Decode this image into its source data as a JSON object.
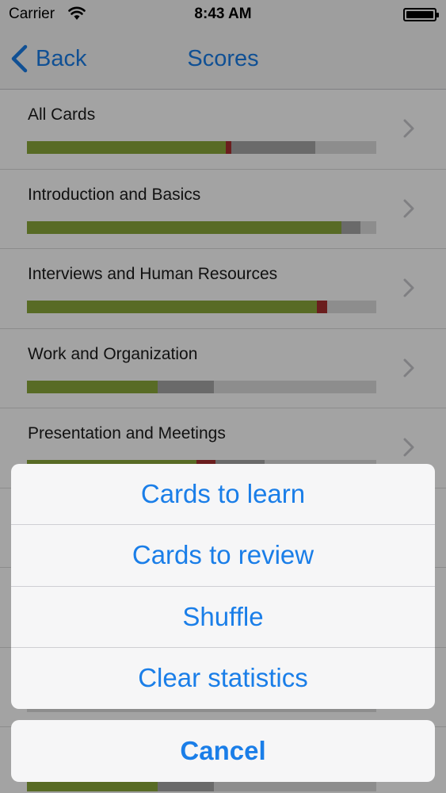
{
  "status_bar": {
    "carrier": "Carrier",
    "time": "8:43 AM"
  },
  "nav": {
    "back_label": "Back",
    "title": "Scores"
  },
  "colors": {
    "accent": "#1a7ee8",
    "correct": "#8aa83a",
    "wrong": "#a83030",
    "seen": "#a6a6a6",
    "unseen": "#dddddd"
  },
  "decks": [
    {
      "name": "All Cards",
      "correct_pct": 57,
      "wrong_pct": 1.5,
      "seen_pct": 24
    },
    {
      "name": "Introduction and Basics",
      "correct_pct": 90,
      "wrong_pct": 0,
      "seen_pct": 5.5
    },
    {
      "name": "Interviews and Human Resources",
      "correct_pct": 83,
      "wrong_pct": 3,
      "seen_pct": 0
    },
    {
      "name": "Work and Organization",
      "correct_pct": 37.5,
      "wrong_pct": 0,
      "seen_pct": 16
    },
    {
      "name": "Presentation and Meetings",
      "correct_pct": 48.5,
      "wrong_pct": 5.5,
      "seen_pct": 14
    },
    {
      "name": "",
      "correct_pct": 0,
      "wrong_pct": 0,
      "seen_pct": 0
    },
    {
      "name": "",
      "correct_pct": 0,
      "wrong_pct": 0,
      "seen_pct": 0
    },
    {
      "name": "",
      "correct_pct": 0,
      "wrong_pct": 0,
      "seen_pct": 0
    },
    {
      "name": "",
      "correct_pct": 37.5,
      "wrong_pct": 0,
      "seen_pct": 16
    }
  ],
  "action_sheet": {
    "options": [
      "Cards to learn",
      "Cards to review",
      "Shuffle",
      "Clear statistics"
    ],
    "cancel_label": "Cancel"
  }
}
